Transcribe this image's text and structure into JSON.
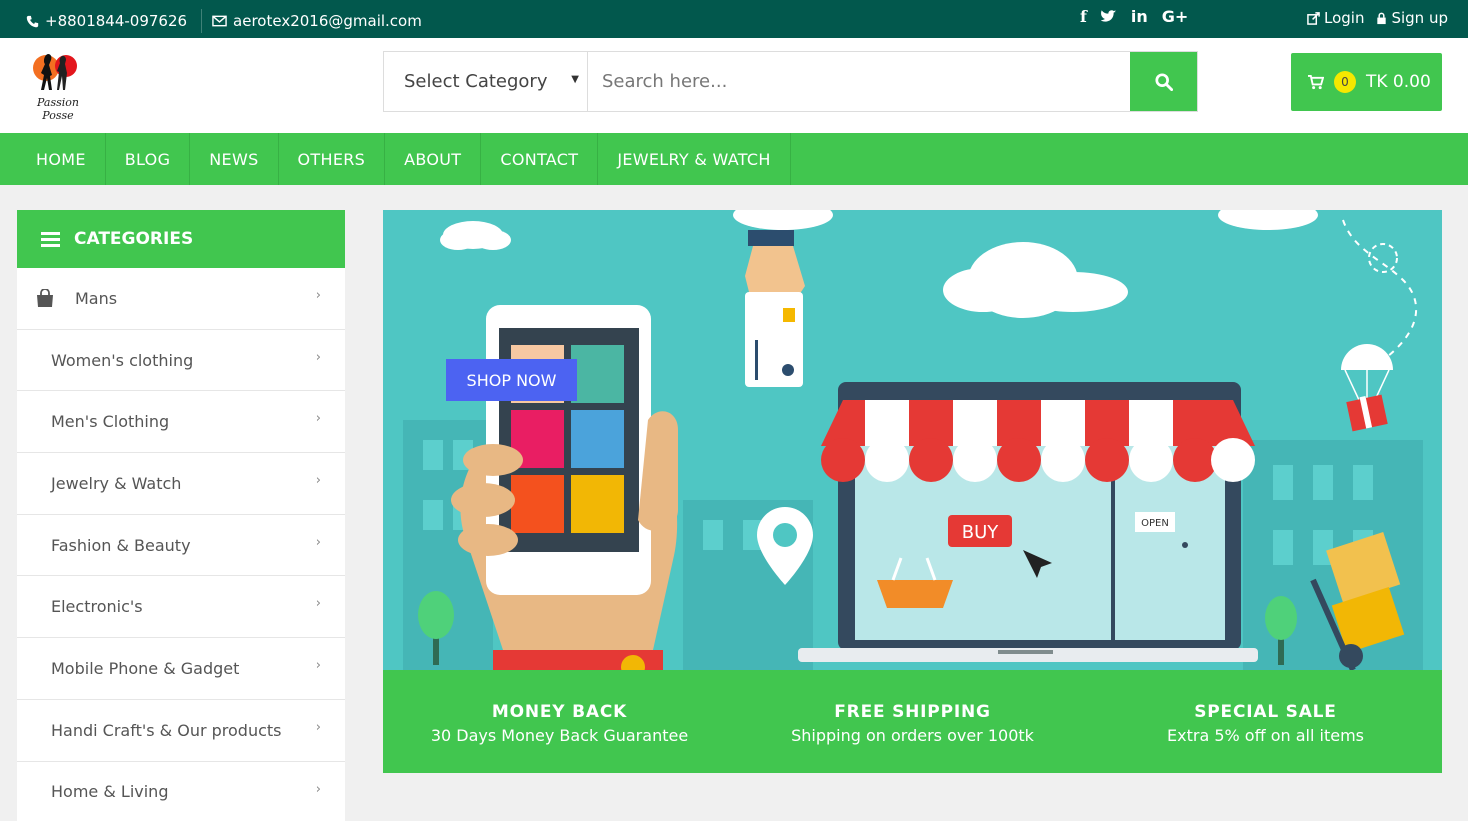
{
  "topbar": {
    "phone": "+8801844-097626",
    "email": "aerotex2016@gmail.com",
    "social": [
      "f",
      "twitter",
      "in",
      "G+"
    ],
    "login": "Login",
    "signup": "Sign up"
  },
  "header": {
    "logo_text": "Passion Posse",
    "category_select": "Select Category",
    "search_placeholder": "Search here...",
    "cart_count": "0",
    "cart_total": "TK 0.00"
  },
  "nav": [
    "HOME",
    "BLOG",
    "NEWS",
    "OTHERS",
    "ABOUT",
    "CONTACT",
    "JEWELRY & WATCH"
  ],
  "sidebar": {
    "title": "CATEGORIES",
    "items": [
      "Mans",
      "Women's clothing",
      "Men's Clothing",
      "Jewelry & Watch",
      "Fashion & Beauty",
      "Electronic's",
      "Mobile Phone & Gadget",
      "Handi Craft's & Our products",
      "Home & Living"
    ]
  },
  "banner": {
    "shop_now": "SHOP NOW",
    "buy": "BUY",
    "open": "OPEN"
  },
  "features": [
    {
      "title": "MONEY BACK",
      "subtitle": "30 Days Money Back Guarantee"
    },
    {
      "title": "FREE SHIPPING",
      "subtitle": "Shipping on orders over 100tk"
    },
    {
      "title": "SPECIAL SALE",
      "subtitle": "Extra 5% off on all items"
    }
  ],
  "colors": {
    "topbar": "#02584d",
    "accent": "#41c64f",
    "banner_bg": "#4fc6c3",
    "shop_now": "#4c63f2"
  }
}
